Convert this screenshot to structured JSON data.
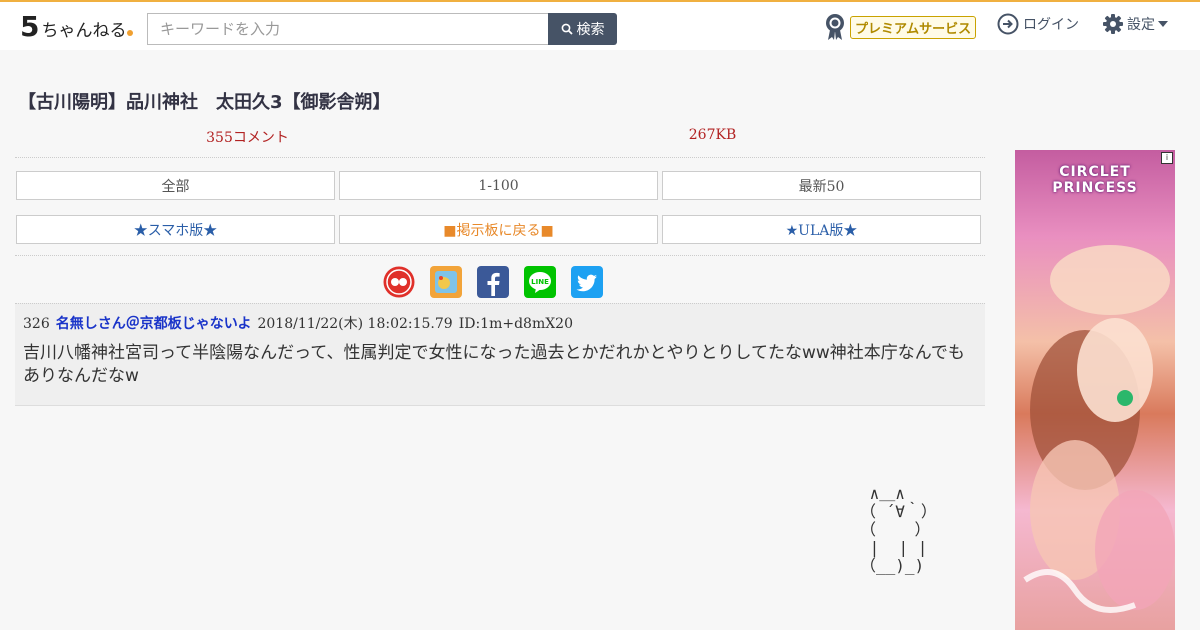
{
  "header": {
    "logo_text": "ちゃんねる",
    "logo_number": "5",
    "search_placeholder": "キーワードを入力",
    "search_button": "検索",
    "premium_label": "プレミアムサービス",
    "login_label": "ログイン",
    "settings_label": "設定"
  },
  "thread": {
    "title": "【古川陽明】品川神社　太田久3【御影舎朔】",
    "comment_count": "355コメント",
    "size": "267KB",
    "nav_row1": [
      "全部",
      "1-100",
      "最新50"
    ],
    "nav_row2": [
      "★スマホ版★",
      "■掲示板に戻る■",
      "★ULA版★"
    ]
  },
  "share_icons": [
    "matome-icon",
    "blog-icon",
    "facebook-icon",
    "line-icon",
    "twitter-icon"
  ],
  "post": {
    "number": "326",
    "name": "名無しさん＠京都板じゃないよ",
    "date": "2018/11/22(木) 18:02:15.79",
    "id": "ID:1m+d8mX20",
    "body": "吉川八幡神社宮司って半陰陽なんだって、性属判定で女性になった過去とかだれかとやりとりしてたなww神社本庁なんでもありなんだなw"
  },
  "ad": {
    "brand": "CIRCLET PRINCESS"
  },
  "colors": {
    "accent": "#465366",
    "comment_red": "#b22222",
    "name_blue": "#1a34c9",
    "premium_gold": "#c9a200"
  }
}
